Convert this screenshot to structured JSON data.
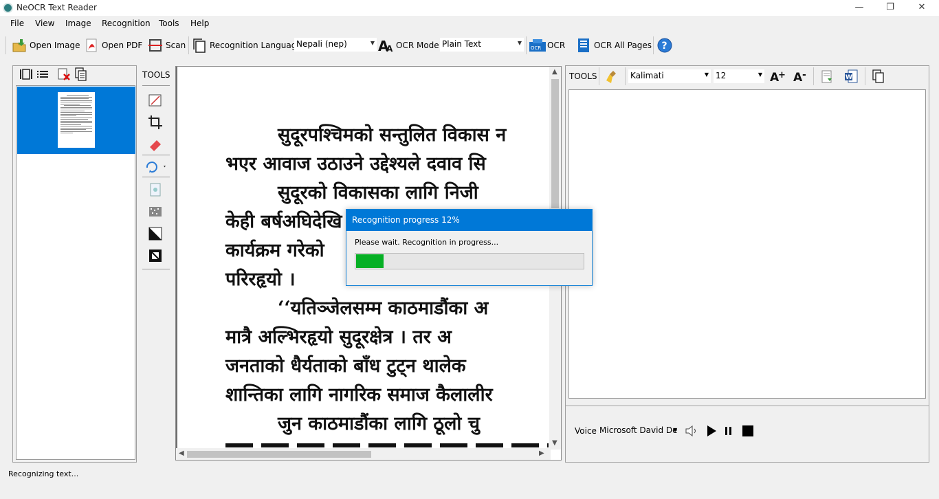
{
  "window": {
    "title": "NeOCR Text Reader",
    "minimize": "—",
    "restore": "❐",
    "close": "✕"
  },
  "menu": [
    {
      "label": "File"
    },
    {
      "label": "View"
    },
    {
      "label": "Image"
    },
    {
      "label": "Recognition"
    },
    {
      "label": "Tools"
    },
    {
      "label": "Help"
    }
  ],
  "toolbar": {
    "open_image": "Open Image",
    "open_pdf": "Open PDF",
    "scan": "Scan",
    "recognition_language_label": "Recognition Language",
    "recognition_language_value": "Nepali (nep)",
    "ocr_mode_label": "OCR Mode",
    "ocr_mode_value": "Plain Text",
    "ocr": "OCR",
    "ocr_all_pages": "OCR All Pages"
  },
  "image_tools": {
    "label": "TOOLS"
  },
  "text_tools": {
    "label": "TOOLS",
    "font": "Kalimati",
    "size": "12"
  },
  "document_lines": [
    "सुदूरपश्चिमको सन्तुलित विकास न",
    "भएर आवाज उठाउने उद्देश्यले दवाव सि",
    "सुदूरको विकासका लागि निजी",
    "केही बर्षअघिदेखि",
    "कार्यक्रम गरेको",
    "परिरहृयो ।",
    "‘‘यतिञ्जेलसम्म काठमाडौंका अ",
    "मात्रै अल्भिरहृयो सुदूरक्षेत्र । तर अ",
    "जनताको धैर्यताको बाँध टुट्न थालेक",
    "शान्तिका लागि नागरिक समाज कैलालीर",
    "जुन काठमाडौंका लागि ठूलो चु"
  ],
  "progress_dialog": {
    "title": "Recognition progress 12%",
    "message": "Please wait. Recognition in progress...",
    "percent": 12,
    "fill_color": "#06b025"
  },
  "voice": {
    "label": "Voice",
    "value": "Microsoft David De"
  },
  "status": "Recognizing text...",
  "colors": {
    "accent": "#0078d7"
  }
}
